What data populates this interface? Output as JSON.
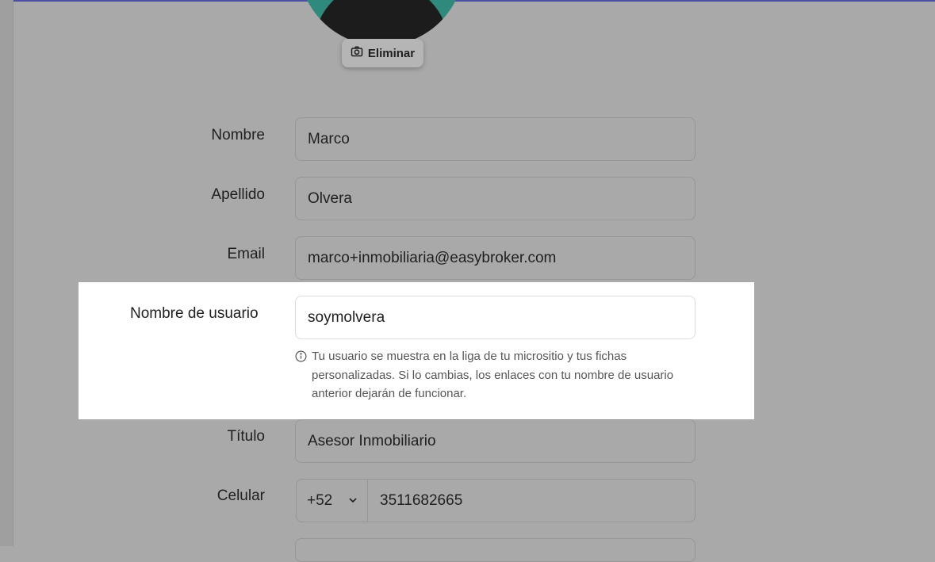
{
  "profile": {
    "remove_photo_label": "Eliminar"
  },
  "form": {
    "first_name": {
      "label": "Nombre",
      "value": "Marco"
    },
    "last_name": {
      "label": "Apellido",
      "value": "Olvera"
    },
    "email": {
      "label": "Email",
      "value": "marco+inmobiliaria@easybroker.com"
    },
    "username": {
      "label": "Nombre de usuario",
      "value": "soymolvera",
      "hint": "Tu usuario se muestra en la liga de tu micrositio y tus fichas personalizadas. Si lo cambias, los enlaces con tu nombre de usuario anterior dejarán de funcionar."
    },
    "title": {
      "label": "Título",
      "value": "Asesor Inmobiliario"
    },
    "phone": {
      "label": "Celular",
      "country_code": "+52",
      "number": "3511682665"
    }
  }
}
